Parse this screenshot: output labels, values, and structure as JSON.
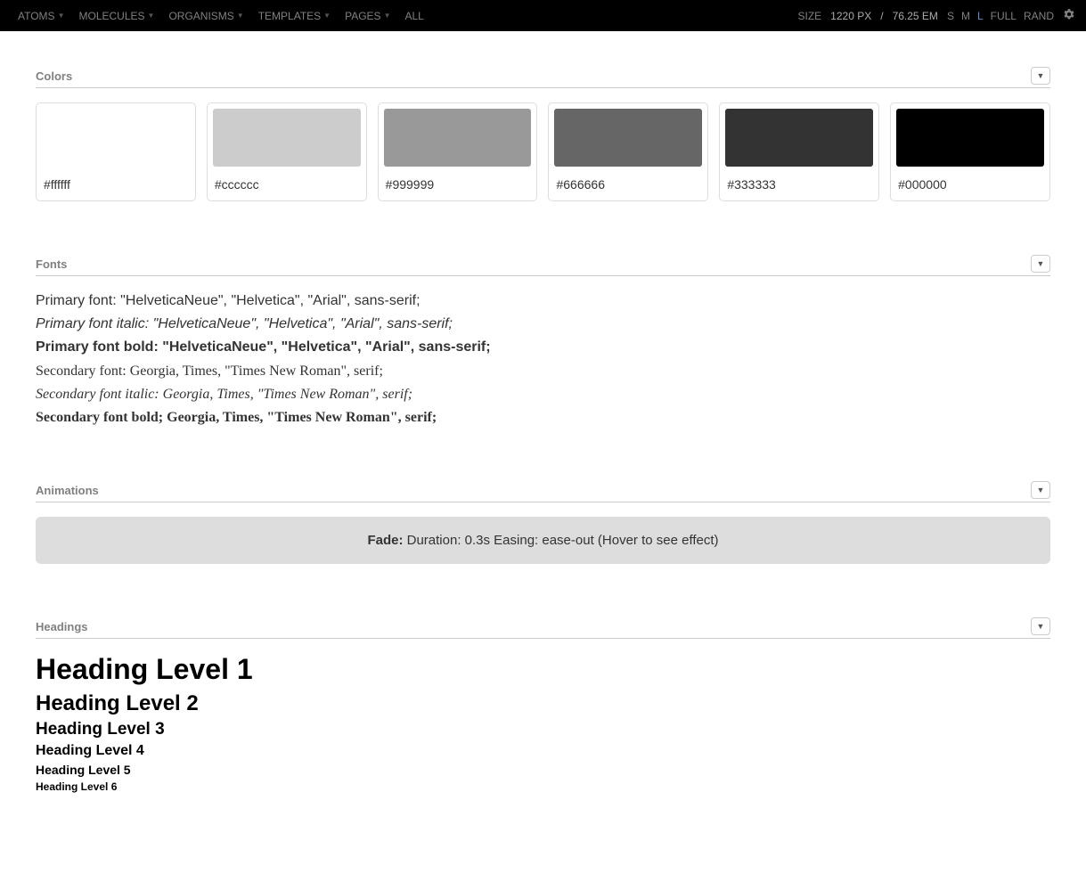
{
  "topbar": {
    "nav": [
      "ATOMS",
      "MOLECULES",
      "ORGANISMS",
      "TEMPLATES",
      "PAGES",
      "ALL"
    ],
    "size_label": "SIZE",
    "size_px": "1220 PX",
    "size_sep": "/",
    "size_em": "76.25 EM",
    "sizes": [
      {
        "label": "S",
        "active": false
      },
      {
        "label": "M",
        "active": false
      },
      {
        "label": "L",
        "active": true
      },
      {
        "label": "FULL",
        "active": false
      },
      {
        "label": "RAND",
        "active": false
      }
    ]
  },
  "sections": {
    "colors": {
      "title": "Colors",
      "swatches": [
        {
          "hex": "#ffffff"
        },
        {
          "hex": "#cccccc"
        },
        {
          "hex": "#999999"
        },
        {
          "hex": "#666666"
        },
        {
          "hex": "#333333"
        },
        {
          "hex": "#000000"
        }
      ]
    },
    "fonts": {
      "title": "Fonts",
      "lines": [
        {
          "text": "Primary font: \"HelveticaNeue\", \"Helvetica\", \"Arial\", sans-serif;",
          "class": ""
        },
        {
          "text": "Primary font italic: \"HelveticaNeue\", \"Helvetica\", \"Arial\", sans-serif;",
          "class": "font-italic"
        },
        {
          "text": "Primary font bold: \"HelveticaNeue\", \"Helvetica\", \"Arial\", sans-serif;",
          "class": "font-bold"
        },
        {
          "text": "Secondary font: Georgia, Times, \"Times New Roman\", serif;",
          "class": "font-serif"
        },
        {
          "text": "Secondary font italic: Georgia, Times, \"Times New Roman\", serif;",
          "class": "font-serif font-italic"
        },
        {
          "text": "Secondary font bold; Georgia, Times, \"Times New Roman\", serif;",
          "class": "font-serif font-bold"
        }
      ]
    },
    "animations": {
      "title": "Animations",
      "label": "Fade:",
      "desc": "Duration: 0.3s Easing: ease-out (Hover to see effect)"
    },
    "headings": {
      "title": "Headings",
      "h1": "Heading Level 1",
      "h2": "Heading Level 2",
      "h3": "Heading Level 3",
      "h4": "Heading Level 4",
      "h5": "Heading Level 5",
      "h6": "Heading Level 6"
    }
  }
}
